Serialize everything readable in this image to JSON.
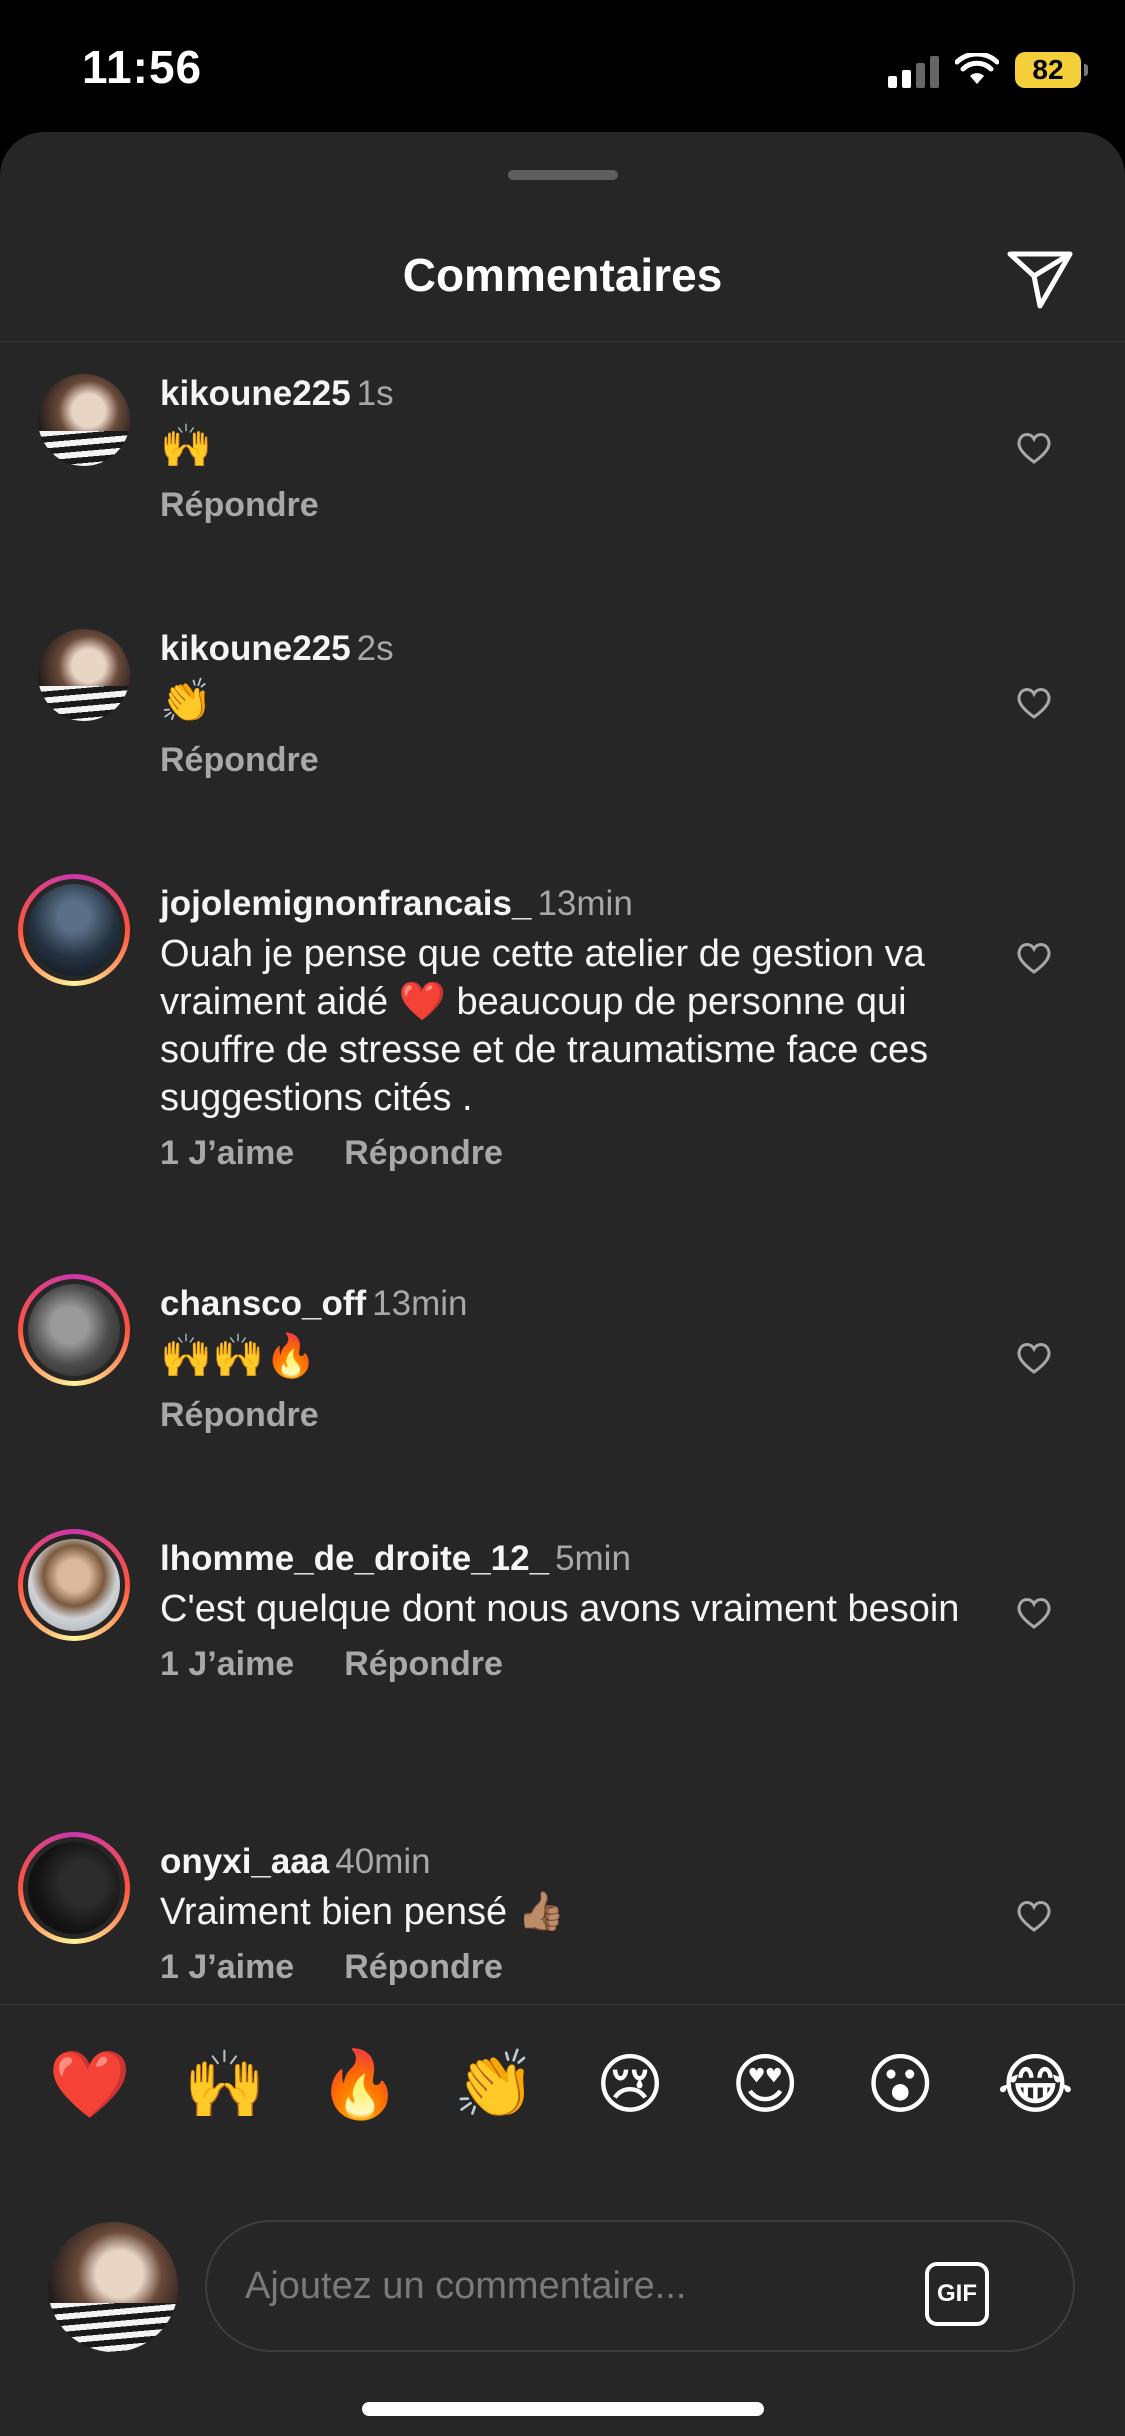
{
  "status": {
    "time": "11:56",
    "battery": "82"
  },
  "sheet": {
    "title": "Commentaires"
  },
  "comments": [
    {
      "user": "kikoune225",
      "time": "1s",
      "text": "🙌",
      "likes": "",
      "reply": "Répondre"
    },
    {
      "user": "kikoune225",
      "time": "2s",
      "text": "👏",
      "likes": "",
      "reply": "Répondre"
    },
    {
      "user": "jojolemignonfrancais_",
      "time": "13min",
      "text": "Ouah je pense que cette atelier de gestion va vraiment aidé ❤️ beaucoup de personne qui souffre de stresse et de traumatisme face ces suggestions cités .",
      "likes": "1 J’aime",
      "reply": "Répondre"
    },
    {
      "user": "chansco_off",
      "time": "13min",
      "text": "🙌🙌🔥",
      "likes": "",
      "reply": "Répondre"
    },
    {
      "user": "lhomme_de_droite_12_",
      "time": "5min",
      "text": "C'est quelque dont nous avons vraiment besoin",
      "likes": "1 J’aime",
      "reply": "Répondre"
    },
    {
      "user": "onyxi_aaa",
      "time": "40min",
      "text": "Vraiment bien pensé 👍🏽",
      "likes": "1 J’aime",
      "reply": "Répondre"
    }
  ],
  "reactions": [
    "❤️",
    "🙌",
    "🔥",
    "👏",
    "😢",
    "😍",
    "😮",
    "😂"
  ],
  "composer": {
    "placeholder": "Ajoutez un commentaire...",
    "gif_label": "GIF"
  },
  "icons": {
    "share": "paper-plane-icon",
    "like": "heart-outline-icon"
  }
}
